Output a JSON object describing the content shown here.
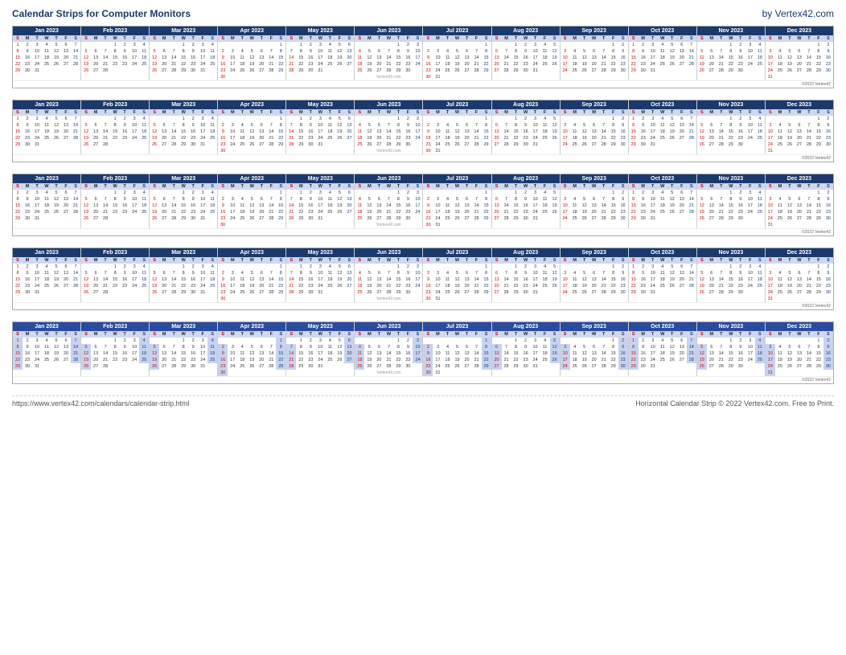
{
  "header": {
    "title": "Calendar Strips for Computer Monitors",
    "brand": "by Vertex42.com"
  },
  "footer": {
    "url": "https://www.vertex42.com/calendars/calendar-strip.html",
    "copyright": "Horizontal Calendar Strip © 2022 Vertex42.com. Free to Print."
  },
  "year": "2023",
  "months": [
    {
      "name": "Jan 2023",
      "startDay": 0,
      "days": 31
    },
    {
      "name": "Feb 2023",
      "startDay": 3,
      "days": 28
    },
    {
      "name": "Mar 2023",
      "startDay": 3,
      "days": 31
    },
    {
      "name": "Apr 2023",
      "startDay": 6,
      "days": 30
    },
    {
      "name": "May 2023",
      "startDay": 1,
      "days": 31
    },
    {
      "name": "Jun 2023",
      "startDay": 4,
      "days": 30
    },
    {
      "name": "Jul 2023",
      "startDay": 6,
      "days": 31
    },
    {
      "name": "Aug 2023",
      "startDay": 2,
      "days": 31
    },
    {
      "name": "Sep 2023",
      "startDay": 5,
      "days": 30
    },
    {
      "name": "Oct 2023",
      "startDay": 0,
      "days": 31
    },
    {
      "name": "Nov 2023",
      "startDay": 3,
      "days": 30
    },
    {
      "name": "Dec 2023",
      "startDay": 5,
      "days": 31
    }
  ],
  "dows": [
    "S",
    "M",
    "T",
    "W",
    "T",
    "F",
    "S"
  ]
}
